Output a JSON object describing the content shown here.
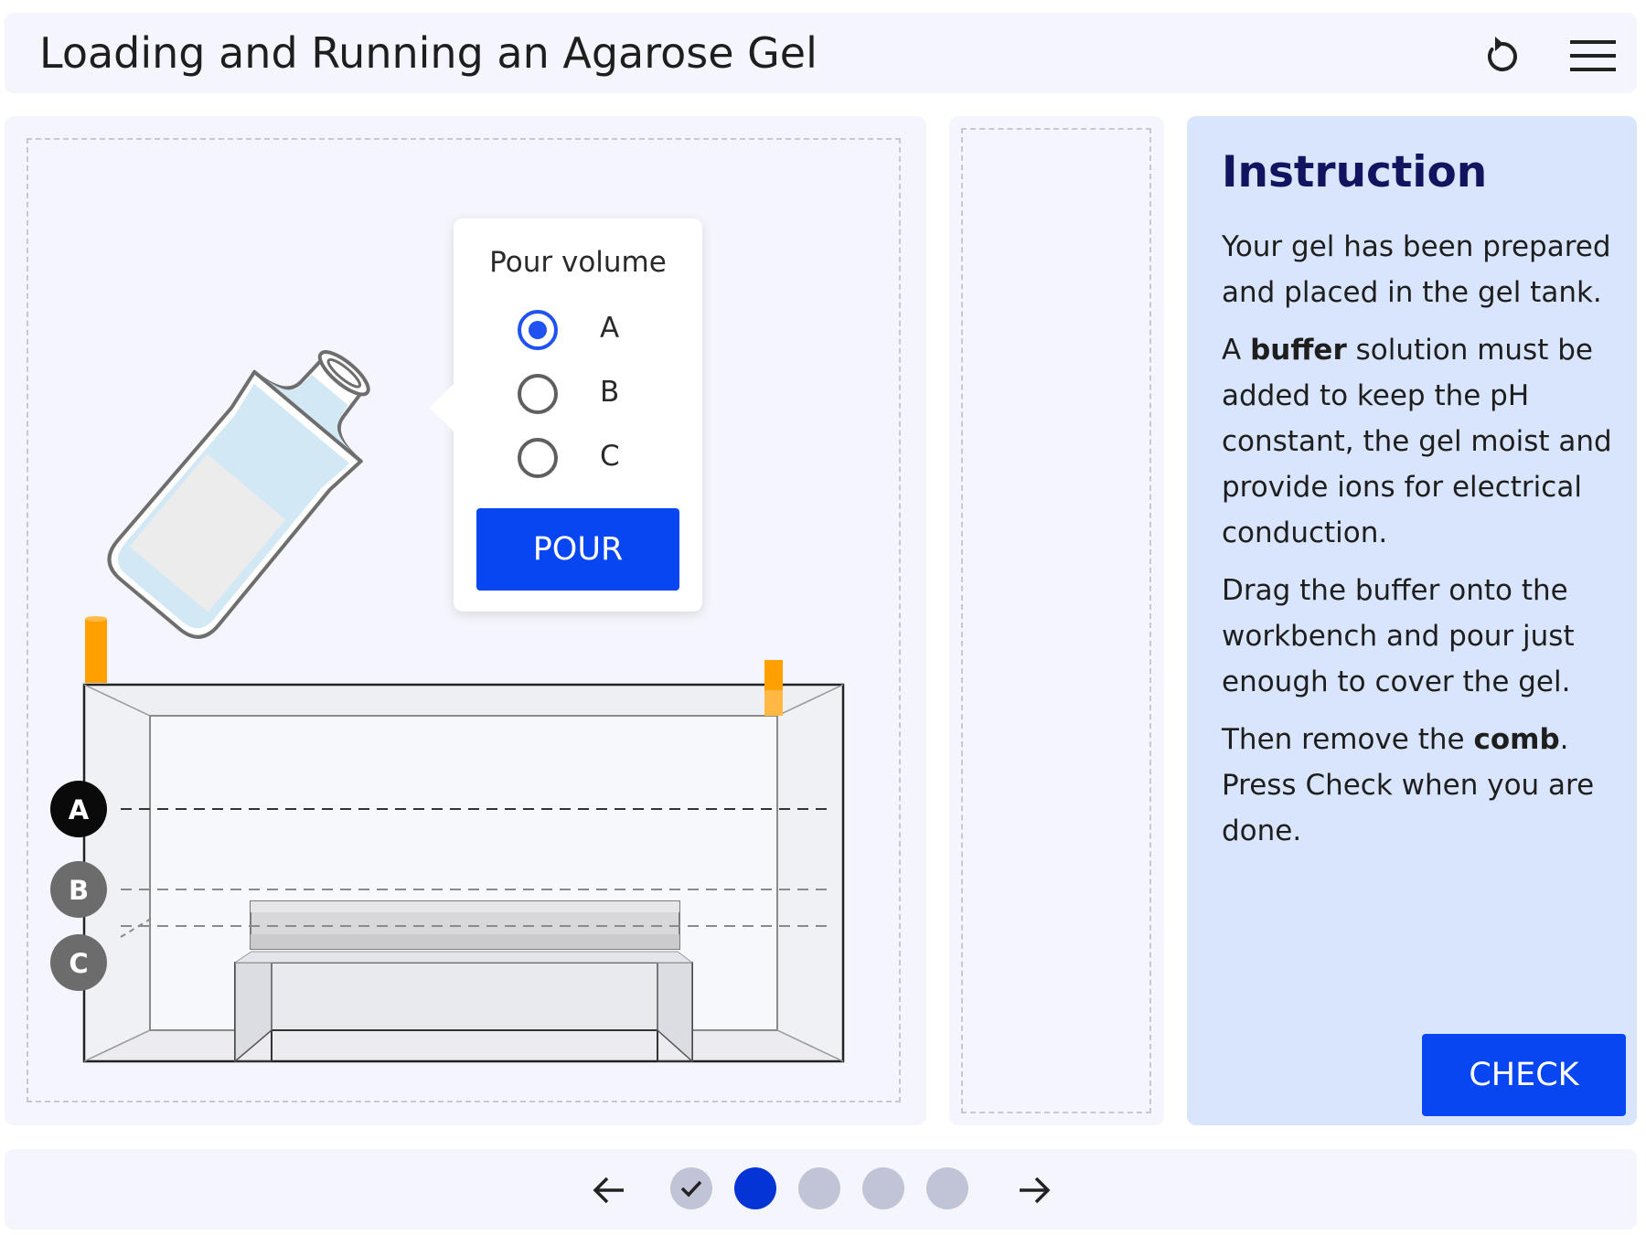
{
  "header": {
    "title": "Loading and Running an Agarose Gel",
    "reset_icon": "reset-icon",
    "menu_icon": "hamburger-menu-icon"
  },
  "workbench": {
    "level_markers": [
      "A",
      "B",
      "C"
    ],
    "pour_popover": {
      "title": "Pour volume",
      "options": [
        {
          "label": "A",
          "selected": true
        },
        {
          "label": "B",
          "selected": false
        },
        {
          "label": "C",
          "selected": false
        }
      ],
      "button_label": "POUR"
    }
  },
  "instruction": {
    "heading": "Instruction",
    "p1": "Your gel has been prepared and placed in the gel tank.",
    "p2_pre": "A ",
    "p2_bold": "buffer",
    "p2_post": " solution must be added to keep the pH constant, the gel moist and provide ions for electrical conduction.",
    "p3": "Drag the buffer onto the workbench and pour just enough to cover the gel.",
    "p4_pre": "Then remove the ",
    "p4_bold": "comb",
    "p4_post": ". Press Check when you are done.",
    "check_label": "CHECK"
  },
  "navigation": {
    "prev_icon": "arrow-left-icon",
    "next_icon": "arrow-right-icon",
    "steps": [
      {
        "state": "completed"
      },
      {
        "state": "current"
      },
      {
        "state": "upcoming"
      },
      {
        "state": "upcoming"
      },
      {
        "state": "upcoming"
      }
    ]
  },
  "colors": {
    "accent": "#0846f2",
    "heading": "#12145f",
    "instruction_bg": "#d9e5fc",
    "panel_bg": "#f5f6fd",
    "electrode": "#ffa000",
    "buffer_liquid": "#d3e8f5"
  }
}
